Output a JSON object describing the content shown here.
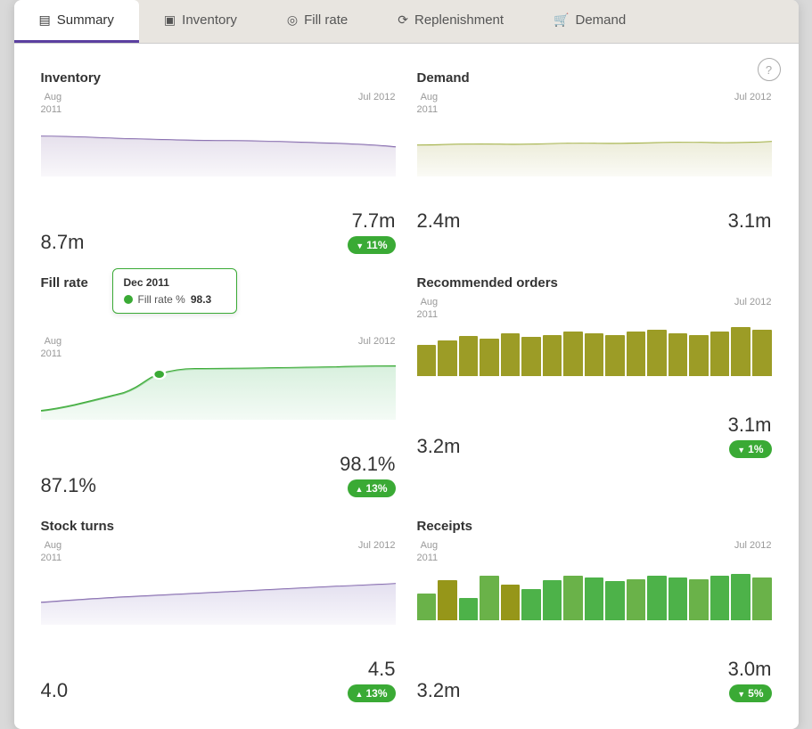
{
  "tabs": [
    {
      "id": "summary",
      "label": "Summary",
      "icon": "▤",
      "active": true
    },
    {
      "id": "inventory",
      "label": "Inventory",
      "icon": "▣"
    },
    {
      "id": "fill-rate",
      "label": "Fill rate",
      "icon": "◎"
    },
    {
      "id": "replenishment",
      "label": "Replenishment",
      "icon": "⟳"
    },
    {
      "id": "demand",
      "label": "Demand",
      "icon": "🛒"
    }
  ],
  "help": "?",
  "cards": {
    "inventory": {
      "title": "Inventory",
      "label_left": "Aug\n2011",
      "label_right": "Jul 2012",
      "val_left": "8.7m",
      "val_right": "7.7m",
      "badge": "▼ 11%",
      "badge_type": "down"
    },
    "demand": {
      "title": "Demand",
      "label_left": "Aug\n2011",
      "label_right": "Jul 2012",
      "val_left": "2.4m",
      "val_right": "3.1m",
      "badge": "",
      "badge_type": ""
    },
    "fill_rate": {
      "title": "Fill rate",
      "label_left": "Aug\n2011",
      "label_right": "Jul 2012",
      "val_left": "87.1%",
      "val_right": "98.1%",
      "badge": "▲ 13%",
      "badge_type": "up-green",
      "tooltip": {
        "date": "Dec 2011",
        "label": "Fill rate %",
        "value": "98.3"
      }
    },
    "recommended_orders": {
      "title": "Recommended orders",
      "label_left": "Aug\n2011",
      "label_right": "Jul 2012",
      "val_left": "3.2m",
      "val_right": "3.1m",
      "badge": "▼ 1%",
      "badge_type": "down"
    },
    "stock_turns": {
      "title": "Stock turns",
      "label_left": "Aug\n2011",
      "label_right": "Jul 2012",
      "val_left": "4.0",
      "val_right": "4.5",
      "badge": "▲ 13%",
      "badge_type": "up-green"
    },
    "receipts": {
      "title": "Receipts",
      "label_left": "Aug\n2011",
      "label_right": "Jul 2012",
      "val_left": "3.2m",
      "val_right": "3.0m",
      "badge": "▼ 5%",
      "badge_type": "down"
    }
  }
}
